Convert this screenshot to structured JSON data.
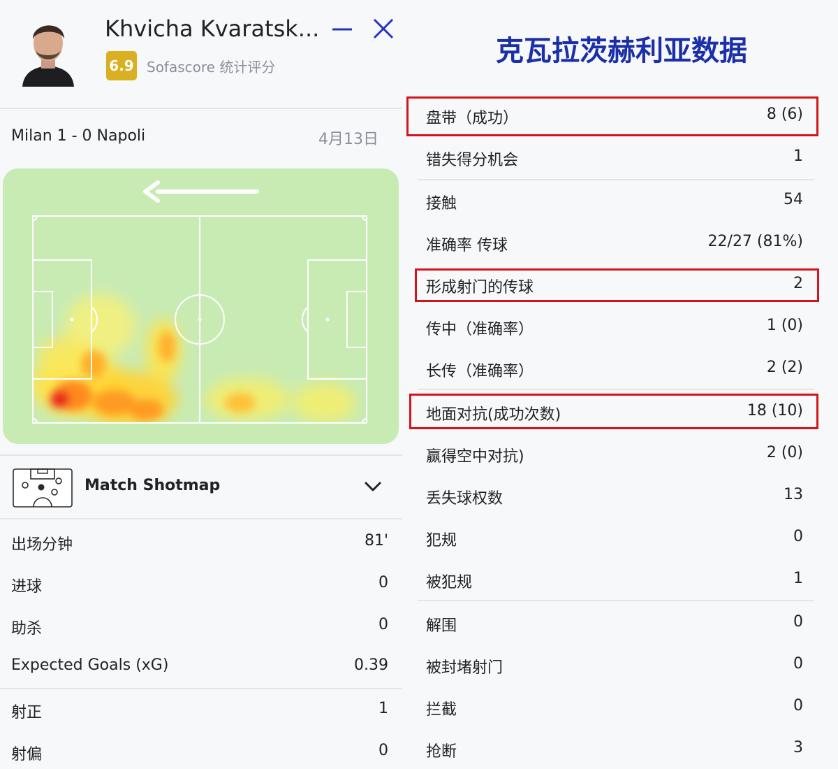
{
  "player": {
    "name": "Khvicha Kvaratsk...",
    "rating": "6.9",
    "rating_label": "Sofascore 统计评分"
  },
  "match": {
    "label": "Milan 1 - 0 Napoli",
    "date": "4月13日"
  },
  "shotmap": {
    "label": "Match Shotmap"
  },
  "left_stats": [
    {
      "label": "出场分钟",
      "value": "81'"
    },
    {
      "label": "进球",
      "value": "0"
    },
    {
      "label": "助杀",
      "value": "0"
    },
    {
      "label": "Expected Goals (xG)",
      "value": "0.39"
    },
    {
      "label": "射正",
      "value": "1"
    },
    {
      "label": "射偏",
      "value": "0"
    }
  ],
  "right_title": "克瓦拉茨赫利亚数据",
  "right_stats": [
    {
      "label": "盘带（成功）",
      "value": "8 (6)",
      "highlight": true
    },
    {
      "label": "错失得分机会",
      "value": "1",
      "highlight": false
    },
    {
      "label": "接触",
      "value": "54",
      "highlight": false
    },
    {
      "label": "准确率 传球",
      "value": "22/27 (81%)",
      "highlight": false
    },
    {
      "label": "形成射门的传球",
      "value": "2",
      "highlight": true
    },
    {
      "label": "传中（准确率）",
      "value": "1 (0)",
      "highlight": false
    },
    {
      "label": "长传（准确率）",
      "value": "2 (2)",
      "highlight": false
    },
    {
      "label": "地面对抗(成功次数)",
      "value": "18 (10)",
      "highlight": true
    },
    {
      "label": "赢得空中对抗)",
      "value": "2 (0)",
      "highlight": false
    },
    {
      "label": "丢失球权数",
      "value": "13",
      "highlight": false
    },
    {
      "label": "犯规",
      "value": "0",
      "highlight": false
    },
    {
      "label": "被犯规",
      "value": "1",
      "highlight": false
    },
    {
      "label": "解围",
      "value": "0",
      "highlight": false
    },
    {
      "label": "被封堵射门",
      "value": "0",
      "highlight": false
    },
    {
      "label": "拦截",
      "value": "0",
      "highlight": false
    },
    {
      "label": "抢断",
      "value": "3",
      "highlight": false
    }
  ],
  "colors": {
    "accent_title": "#1b2fa8",
    "highlight_border": "#d4141d",
    "rating_badge": "#d9b021",
    "pitch": "#c8ebb4"
  },
  "icons": [
    "minimize-icon",
    "close-icon",
    "shotmap-icon",
    "chevron-down-icon",
    "direction-arrow-icon"
  ]
}
